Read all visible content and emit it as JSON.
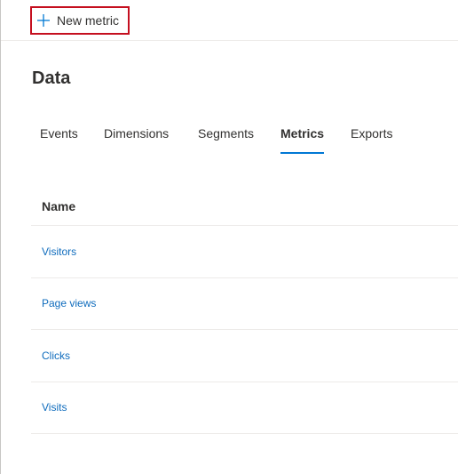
{
  "command_bar": {
    "new_metric_label": "New metric",
    "new_metric_icon": "plus-icon"
  },
  "page": {
    "title": "Data"
  },
  "tabs": [
    {
      "label": "Events",
      "selected": false
    },
    {
      "label": "Dimensions",
      "selected": false
    },
    {
      "label": "Segments",
      "selected": false
    },
    {
      "label": "Metrics",
      "selected": true
    },
    {
      "label": "Exports",
      "selected": false
    }
  ],
  "table": {
    "columns": [
      "Name"
    ],
    "rows": [
      {
        "name": "Visitors"
      },
      {
        "name": "Page views"
      },
      {
        "name": "Clicks"
      },
      {
        "name": "Visits"
      }
    ]
  },
  "colors": {
    "accent": "#0078d4",
    "link": "#0f6cbd",
    "highlight_border": "#c50f1f"
  }
}
